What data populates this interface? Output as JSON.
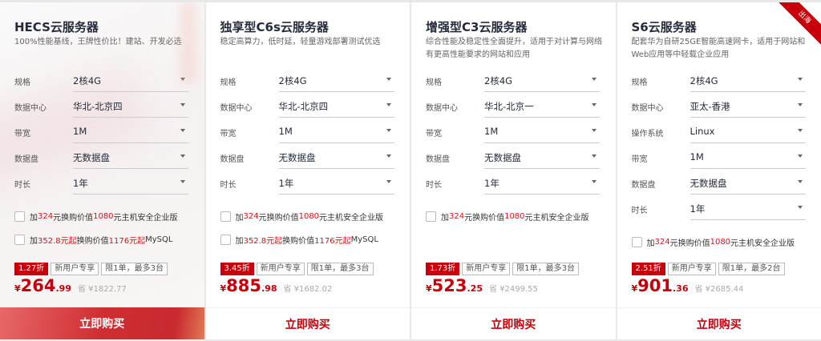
{
  "cards": [
    {
      "title": "HECS云服务器",
      "subtitle": "100%性能基线，王牌性价比！建站、开发必选",
      "options": [
        {
          "label": "规格",
          "value": "2核4G"
        },
        {
          "label": "数据中心",
          "value": "华北-北京四"
        },
        {
          "label": "带宽",
          "value": "1M"
        },
        {
          "label": "数据盘",
          "value": "无数据盘"
        },
        {
          "label": "时长",
          "value": "1年"
        }
      ],
      "addons": [
        [
          {
            "t": "加",
            "red": false
          },
          {
            "t": "324",
            "red": true
          },
          {
            "t": "元换购价值",
            "red": false
          },
          {
            "t": "1080",
            "red": true
          },
          {
            "t": "元主机安全企业版",
            "red": false
          }
        ],
        [
          {
            "t": "加",
            "red": false
          },
          {
            "t": "352.8元起",
            "red": true
          },
          {
            "t": "换购价值",
            "red": false
          },
          {
            "t": "1176元起",
            "red": true
          },
          {
            "t": "MySQL",
            "red": false
          }
        ]
      ],
      "tags": [
        "1.27折",
        "新用户专享",
        "限1单，最多3台"
      ],
      "price": {
        "currency": "¥",
        "int": "264",
        "dec": ".99",
        "save": "省 ¥1822.77"
      },
      "buy": "立即购买"
    },
    {
      "title": "独享型C6s云服务器",
      "subtitle": "稳定高算力，低时延，轻量游戏部署测试优选",
      "options": [
        {
          "label": "规格",
          "value": "2核4G"
        },
        {
          "label": "数据中心",
          "value": "华北-北京四"
        },
        {
          "label": "带宽",
          "value": "1M"
        },
        {
          "label": "数据盘",
          "value": "无数据盘"
        },
        {
          "label": "时长",
          "value": "1年"
        }
      ],
      "addons": [
        [
          {
            "t": "加",
            "red": false
          },
          {
            "t": "324",
            "red": true
          },
          {
            "t": "元换购价值",
            "red": false
          },
          {
            "t": "1080",
            "red": true
          },
          {
            "t": "元主机安全企业版",
            "red": false
          }
        ],
        [
          {
            "t": "加",
            "red": false
          },
          {
            "t": "352.8元起",
            "red": true
          },
          {
            "t": "换购价值",
            "red": false
          },
          {
            "t": "1176元起",
            "red": true
          },
          {
            "t": "MySQL",
            "red": false
          }
        ]
      ],
      "tags": [
        "3.45折",
        "新用户专享",
        "限1单，最多3台"
      ],
      "price": {
        "currency": "¥",
        "int": "885",
        "dec": ".98",
        "save": "省 ¥1682.02"
      },
      "buy": "立即购买"
    },
    {
      "title": "增强型C3云服务器",
      "subtitle": "综合性能及稳定性全面提升，适用于对计算与网络有更高性能要求的网站和应用",
      "options": [
        {
          "label": "规格",
          "value": "2核4G"
        },
        {
          "label": "数据中心",
          "value": "华北-北京一"
        },
        {
          "label": "带宽",
          "value": "1M"
        },
        {
          "label": "数据盘",
          "value": "无数据盘"
        },
        {
          "label": "时长",
          "value": "1年"
        }
      ],
      "addons": [
        [
          {
            "t": "加",
            "red": false
          },
          {
            "t": "324",
            "red": true
          },
          {
            "t": "元换购价值",
            "red": false
          },
          {
            "t": "1080",
            "red": true
          },
          {
            "t": "元主机安全企业版",
            "red": false
          }
        ]
      ],
      "tags": [
        "1.73折",
        "新用户专享",
        "限1单，最多3台"
      ],
      "price": {
        "currency": "¥",
        "int": "523",
        "dec": ".25",
        "save": "省 ¥2499.55"
      },
      "buy": "立即购买"
    },
    {
      "title": "S6云服务器",
      "subtitle": "配套华为自研25GE智能高速网卡，适用于网站和Web应用等中轻载企业应用",
      "ribbon": "出海",
      "options": [
        {
          "label": "规格",
          "value": "2核4G"
        },
        {
          "label": "数据中心",
          "value": "亚太-香港"
        },
        {
          "label": "操作系统",
          "value": "Linux"
        },
        {
          "label": "带宽",
          "value": "1M"
        },
        {
          "label": "数据盘",
          "value": "无数据盘"
        },
        {
          "label": "时长",
          "value": "1年"
        }
      ],
      "addons": [
        [
          {
            "t": "加",
            "red": false
          },
          {
            "t": "324",
            "red": true
          },
          {
            "t": "元换购价值",
            "red": false
          },
          {
            "t": "1080",
            "red": true
          },
          {
            "t": "元主机安全企业版",
            "red": false
          }
        ]
      ],
      "tags": [
        "2.51折",
        "新用户专享",
        "限1单，最多2台"
      ],
      "price": {
        "currency": "¥",
        "int": "901",
        "dec": ".36",
        "save": "省 ¥2685.44"
      },
      "buy": "立即购买"
    }
  ]
}
